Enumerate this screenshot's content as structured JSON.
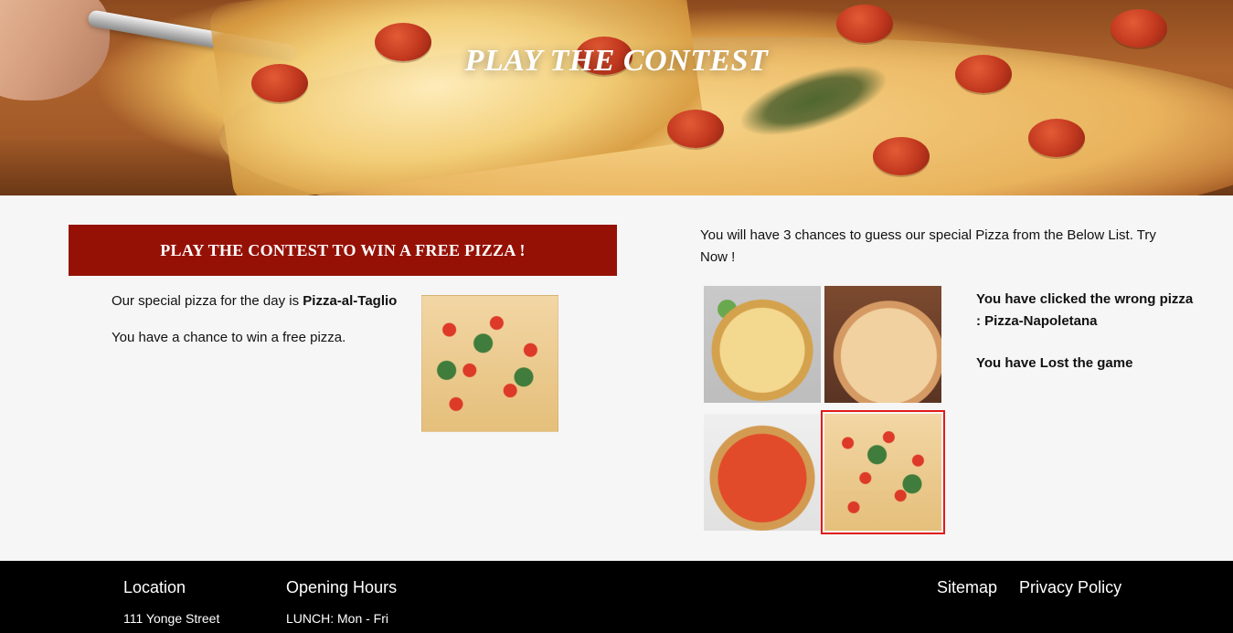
{
  "hero": {
    "title": "PLAY THE CONTEST"
  },
  "contest": {
    "banner": "PLAY THE CONTEST TO WIN A FREE PIZZA !",
    "special_pizza_prefix": "Our special pizza for the day is ",
    "special_pizza_name": "Pizza-al-Taglio",
    "win_text": "You have a chance to win a free pizza."
  },
  "right": {
    "intro": "You will have 3 chances to guess our special Pizza from the Below List. Try Now !",
    "result_line1": "You have clicked the wrong pizza : Pizza-Napoletana",
    "result_line2": "You have Lost the game"
  },
  "footer": {
    "location_heading": "Location",
    "location_line": "111 Yonge Street",
    "hours_heading": "Opening Hours",
    "hours_line": "LUNCH: Mon - Fri",
    "links": [
      {
        "label": "Sitemap"
      },
      {
        "label": "Privacy Policy"
      }
    ]
  },
  "colors": {
    "banner_bg": "#951106",
    "selected_outline": "#e21a1a",
    "footer_bg": "#000000",
    "page_bg": "#f6f6f6"
  }
}
